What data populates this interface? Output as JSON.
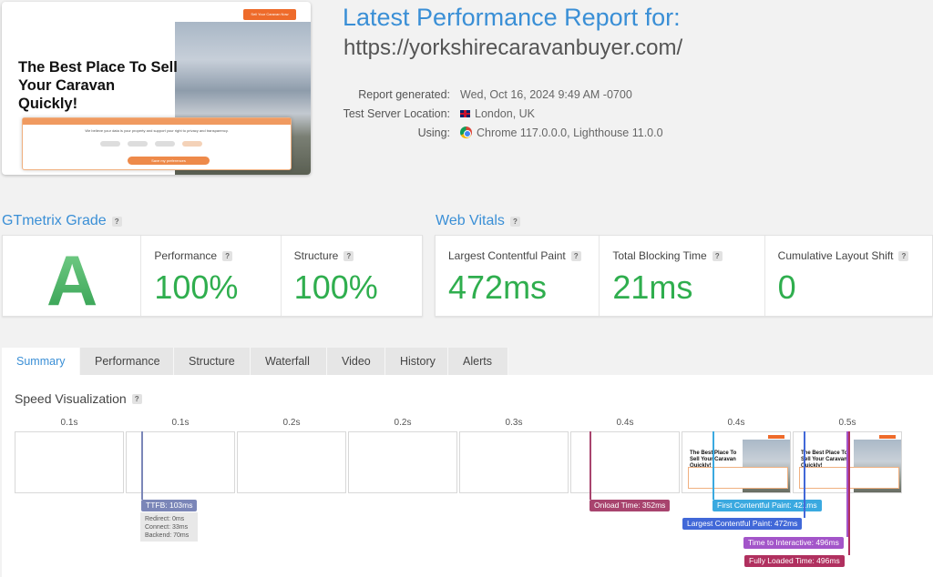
{
  "header": {
    "title": "Latest Performance Report for:",
    "url": "https://yorkshirecaravanbuyer.com/",
    "meta": [
      {
        "label": "Report generated:",
        "value": "Wed, Oct 16, 2024 9:49 AM -0700",
        "icon": ""
      },
      {
        "label": "Test Server Location:",
        "value": "London, UK",
        "icon": "uk-flag-icon"
      },
      {
        "label": "Using:",
        "value": "Chrome 117.0.0.0, Lighthouse 11.0.0",
        "icon": "chrome-icon"
      }
    ],
    "thumbnail": {
      "headline": "The Best Place To Sell Your Caravan Quickly!",
      "cta": "Sell Your Caravan Now",
      "consent_text": "We believe your data is your property and support your right to privacy and transparency.",
      "consent_button": "Save my preferences"
    }
  },
  "grade": {
    "title": "GTmetrix Grade",
    "letter": "A",
    "performance_label": "Performance",
    "performance_value": "100%",
    "structure_label": "Structure",
    "structure_value": "100%"
  },
  "vitals": {
    "title": "Web Vitals",
    "lcp_label": "Largest Contentful Paint",
    "lcp_value": "472ms",
    "tbt_label": "Total Blocking Time",
    "tbt_value": "21ms",
    "cls_label": "Cumulative Layout Shift",
    "cls_value": "0"
  },
  "tabs": [
    "Summary",
    "Performance",
    "Structure",
    "Waterfall",
    "Video",
    "History",
    "Alerts"
  ],
  "active_tab": "Summary",
  "speed": {
    "title": "Speed Visualization",
    "frame_times": [
      "0.1s",
      "0.1s",
      "0.2s",
      "0.2s",
      "0.3s",
      "0.4s",
      "0.4s",
      "0.5s"
    ],
    "frame_headline": "The Best Place To Sell Your Caravan Quickly!",
    "ttfb": "TTFB: 103ms",
    "ttfb_details": [
      "Redirect: 0ms",
      "Connect: 33ms",
      "Backend: 70ms"
    ],
    "onload": "Onload Time: 352ms",
    "fcp": "First Contentful Paint: 421ms",
    "lcp": "Largest Contentful Paint: 472ms",
    "tti": "Time to Interactive: 496ms",
    "fully_loaded": "Fully Loaded Time: 496ms"
  },
  "colors": {
    "accent": "#3a8fd6",
    "good": "#2fae4e",
    "ttfb": "#7b86b8",
    "onload": "#a8446e",
    "fcp": "#3aa9e0",
    "lcp": "#4168d8",
    "tti": "#a355c9",
    "fully_loaded": "#b0305f"
  }
}
